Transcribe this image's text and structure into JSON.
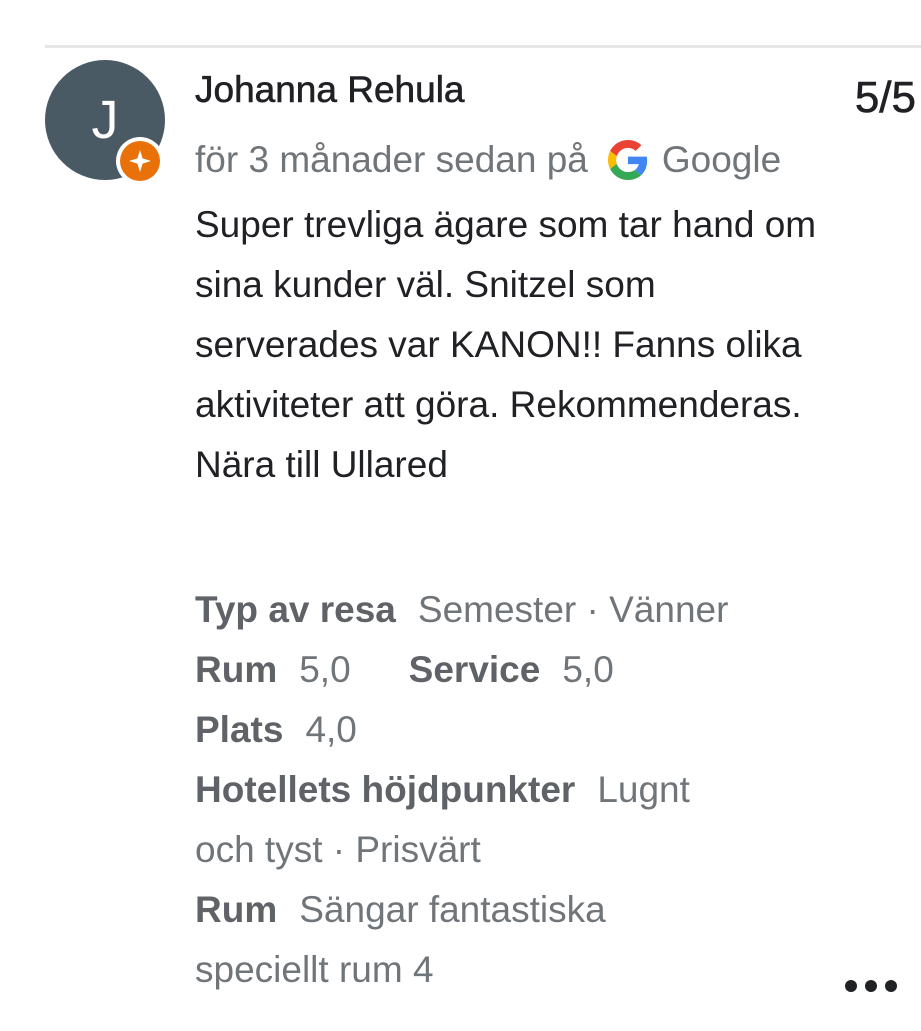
{
  "review": {
    "avatar_letter": "J",
    "reviewer_name": "Johanna Rehula",
    "score": "5/5",
    "time_ago": "för 3 månader sedan på",
    "source": "Google",
    "text": "Super trevliga ägare som tar hand om sina kunder väl. Snitzel som serverades var KANON!! Fanns olika aktiviteter att göra. Rekommenderas. Nära till Ullared"
  },
  "details": {
    "trip_label": "Typ av resa",
    "trip_value": "Semester · Vänner",
    "room_label": "Rum",
    "room_value": "5,0",
    "service_label": "Service",
    "service_value": "5,0",
    "location_label": "Plats",
    "location_value": "4,0",
    "highlights_label": "Hotellets höjdpunkter",
    "highlights_value_1": "Lugnt",
    "highlights_value_2": "och tyst · Prisvärt",
    "room_note_label": "Rum",
    "room_note_value_1": "Sängar fantastiska",
    "room_note_value_2": "speciellt rum 4"
  },
  "icons": {
    "avatar_badge": "local-guide-star-icon",
    "source_logo": "google-g-icon",
    "more": "more-horizontal-icon"
  },
  "colors": {
    "avatar_bg": "#4a5a64",
    "badge": "#e8710a",
    "secondary_text": "#70757a",
    "primary_text": "#202124"
  }
}
